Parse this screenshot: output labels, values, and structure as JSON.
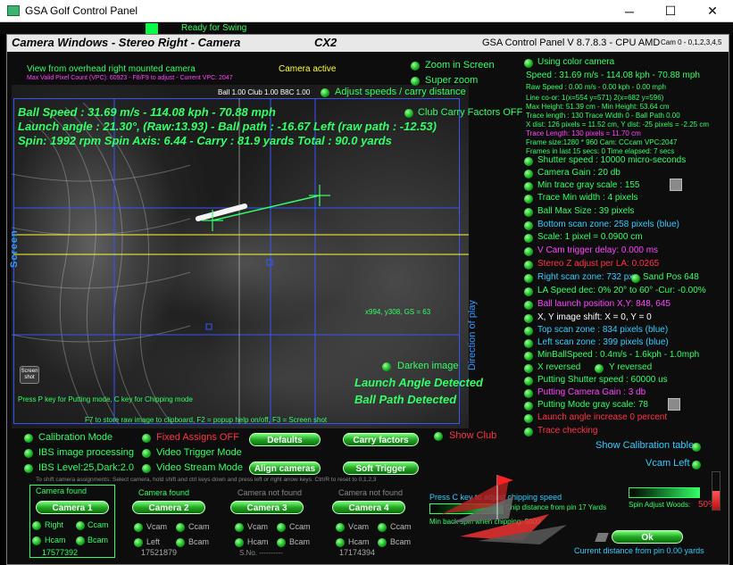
{
  "window": {
    "title": "GSA Golf Control Panel",
    "minimize": "─",
    "maximize": "☐",
    "close": "✕"
  },
  "header": {
    "status": "Ready for Swing",
    "panel_title": "Camera Windows - Stereo Right - Camera",
    "model": "CX2",
    "version": "GSA Control Panel V 8.7.8.3 - CPU AMD",
    "cam_info": "Cam 0 - 0,1,2,3,4,5"
  },
  "camera_view": {
    "view_label": "View from overhead right mounted camera",
    "active_label": "Camera active",
    "vpc_info": "Max Valid Pixel Count (VPC): 60923 - F8/F9 to adjust - Current VPC: 2047",
    "ball_club_info": "Ball 1.00 Club 1.00 B8C 1.00",
    "ball_speed": "Ball Speed : 31.69 m/s - 114.08 kph - 70.88 mph",
    "launch_angle": "Launch angle : 21.30°, (Raw:13.93) - Ball path : -16.67 Left (raw path : -12.53)",
    "spin": "Spin: 1992 rpm  Spin Axis: 6.44 - Carry : 81.9 yards  Total : 90.0 yards",
    "coords": "x994, y308, GS = 63",
    "screen_label": "Screen",
    "direction_label": "Direction of play",
    "screenshot_btn": "Screen shot",
    "putting_help": "Press P key for Putting mode, C key for Chipping mode",
    "f_keys_help": "F7 to store raw image to clipboard, F2 = popup help on/off, F3 = Screen shot",
    "launch_detected": "Launch Angle Detected",
    "path_detected": "Ball Path Detected"
  },
  "overlay_options": {
    "zoom_in_screen": "Zoom in Screen",
    "super_zoom": "Super zoom",
    "adjust_speeds": "Adjust speeds / carry distance",
    "club_carry_factors": "Club Carry Factors OFF",
    "darken_image": "Darken image"
  },
  "right_panel": {
    "using_color": "Using color camera",
    "speed": "Speed : 31.69 m/s - 114.08 kph - 70.88 mph",
    "raw_speed": "Raw Speed : 0.00 m/s - 0.00 kph - 0.00 mph",
    "line_coords": "Line co-or: 1(x=554 y=571) 2(x=682 y=596)",
    "max_height": "Max Height: 51.39 cm - Min Height: 53.64 cm",
    "trace_length": "Trace length : 130 Trace Width 0 - Ball Path 0.00",
    "x_dist": "X dist: 126 pixels = 11.52 cm, Y dist: -25 pixels = -2.25 cm",
    "trace_length_cm": "Trace Length: 130 pixels = 11.70 cm",
    "frame_size": "Frame size:1280 * 960 Cam: CCcam VPC:2047",
    "frames_elapsed": "Frames in last 15 secs: 0 Time elapsed:   7 secs",
    "shutter_speed": "Shutter speed : 10000 micro-seconds",
    "camera_gain": "Camera Gain : 20 db",
    "min_trace_gray": "Min trace gray scale : 155",
    "trace_min_width": "Trace Min width : 4 pixels",
    "ball_max_size": "Ball Max Size : 39 pixels",
    "bottom_scan": "Bottom scan zone: 258 pixels (blue)",
    "scale": "Scale: 1 pixel = 0.0900 cm",
    "v_cam_trigger": "V Cam trigger delay: 0.000 ms",
    "stereo_z": "Stereo Z adjust per LA: 0.0265",
    "right_scan": "Right scan zone: 732 px",
    "sand_pos": "Sand Pos 648",
    "la_speed_dec": "LA Speed dec: 0% 20° to 60° -Cur: -0.00%",
    "ball_launch_pos": "Ball launch position X,Y: 848, 645",
    "xy_shift": "X, Y image shift: X = 0, Y = 0",
    "top_scan": "Top scan zone : 834 pixels (blue)",
    "left_scan": "Left scan zone : 399 pixels (blue)",
    "min_ball_speed": "MinBallSpeed : 0.4m/s - 1.6kph - 1.0mph",
    "x_reversed": "X reversed",
    "y_reversed": "Y reversed",
    "putting_shutter": "Putting Shutter speed : 60000 us",
    "putting_gain": "Putting Camera Gain : 3 db",
    "putting_gray": "Putting Mode gray scale: 78",
    "launch_angle_inc": "Launch angle increase 0 percent",
    "trace_checking": "Trace checking",
    "show_calibration": "Show Calibration table",
    "vcam_left": "Vcam Left"
  },
  "controls": {
    "calibration_mode": "Calibration Mode",
    "fixed_assigns": "Fixed Assigns OFF",
    "defaults_btn": "Defaults",
    "carry_factors_btn": "Carry factors",
    "show_club": "Show Club",
    "ibs_processing": "IBS image processing",
    "video_trigger": "Video Trigger Mode",
    "ibs_level": "IBS Level:25,Dark:2.0",
    "video_stream": "Video Stream Mode",
    "align_cameras_btn": "Align cameras",
    "soft_trigger_btn": "Soft Trigger",
    "shift_help": "To shift camera assignments: Select camera, hold shift and ctrl keys down and press left or right arrow keys.  Ctrl/R to reset to 0,1,2,3"
  },
  "cameras": [
    {
      "status": "Camera found",
      "button": "Camera 1",
      "opt1": "Right",
      "opt2": "Ccam",
      "opt3": "Hcam",
      "opt4": "Bcam",
      "serial": "17577392"
    },
    {
      "status": "Camera found",
      "button": "Camera 2",
      "opt1": "Vcam",
      "opt2": "Ccam",
      "opt3": "Left",
      "opt4": "Bcam",
      "serial": "17521879"
    },
    {
      "status": "Camera not found",
      "button": "Camera 3",
      "opt1": "Vcam",
      "opt2": "Ccam",
      "opt3": "Hcam",
      "opt4": "Bcam",
      "serial": "S.No. ----------"
    },
    {
      "status": "Camera not found",
      "button": "Camera 4",
      "opt1": "Vcam",
      "opt2": "Ccam",
      "opt3": "Hcam",
      "opt4": "Bcam",
      "serial": "17174394"
    }
  ],
  "chipping": {
    "press_c": "Press C key to adjust chipping speed",
    "chip_distance": "Chip distance from pin 17 Yards",
    "min_back_spin": "Min back spin when chipping: 5000",
    "spin_adjust": "Spin Adjust Woods:",
    "spin_adjust_value": "50%",
    "spin_level": 0.5,
    "ok_btn": "Ok",
    "current_distance": "Current distance from pin 0.00 yards"
  },
  "colors": {
    "green_text": "#33ff66",
    "cyan_text": "#33ccff",
    "red_text": "#ff3344",
    "magenta_text": "#ff44ff",
    "white_text": "#ffffff",
    "scan_zone_blue": "#3355ff"
  }
}
